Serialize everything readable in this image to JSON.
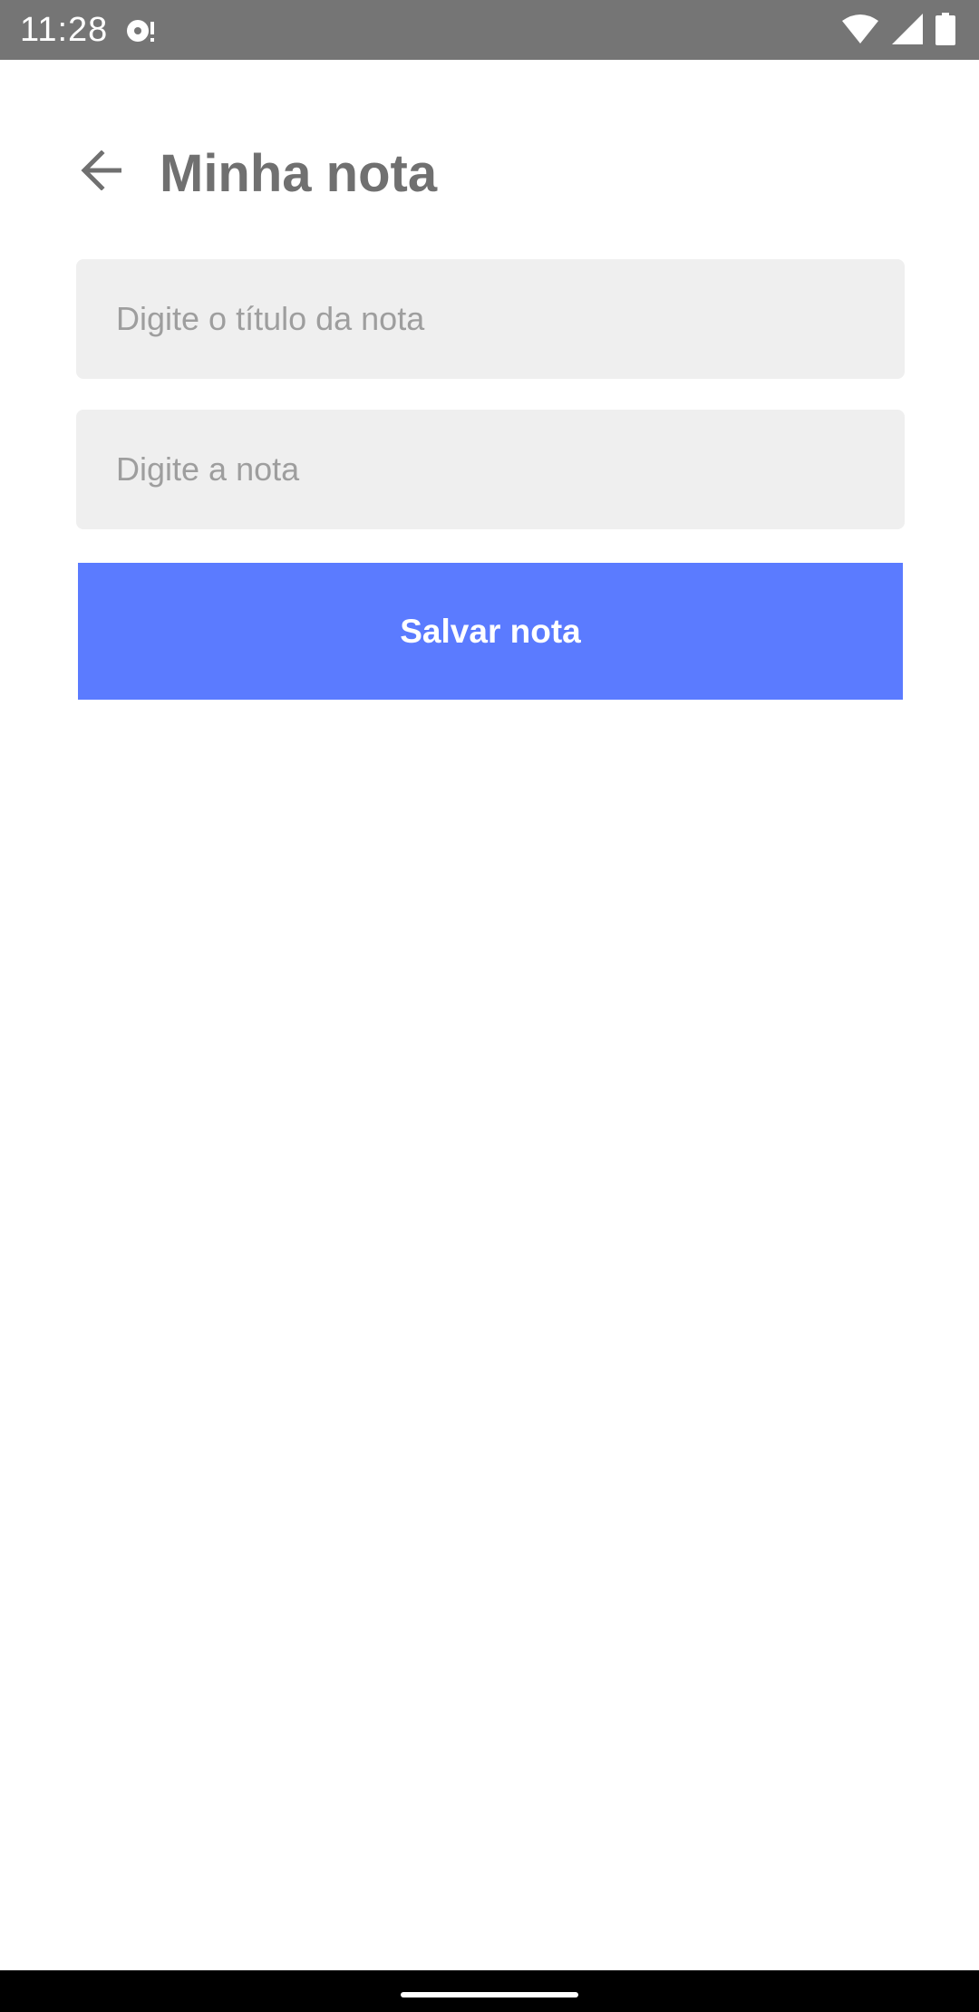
{
  "status_bar": {
    "time": "11:28",
    "icons": [
      "media-icon",
      "wifi-icon",
      "signal-icon",
      "battery-icon"
    ]
  },
  "header": {
    "title": "Minha nota",
    "back_icon": "arrow-left-icon"
  },
  "form": {
    "title_input": {
      "value": "",
      "placeholder": "Digite o título da nota"
    },
    "note_input": {
      "value": "",
      "placeholder": "Digite a nota"
    },
    "save_label": "Salvar nota"
  },
  "colors": {
    "status_bar": "#757575",
    "title_text": "#707070",
    "input_background": "#efefef",
    "placeholder_text": "#9e9e9e",
    "accent": "#5b7bff",
    "nav_bar": "#000000"
  }
}
